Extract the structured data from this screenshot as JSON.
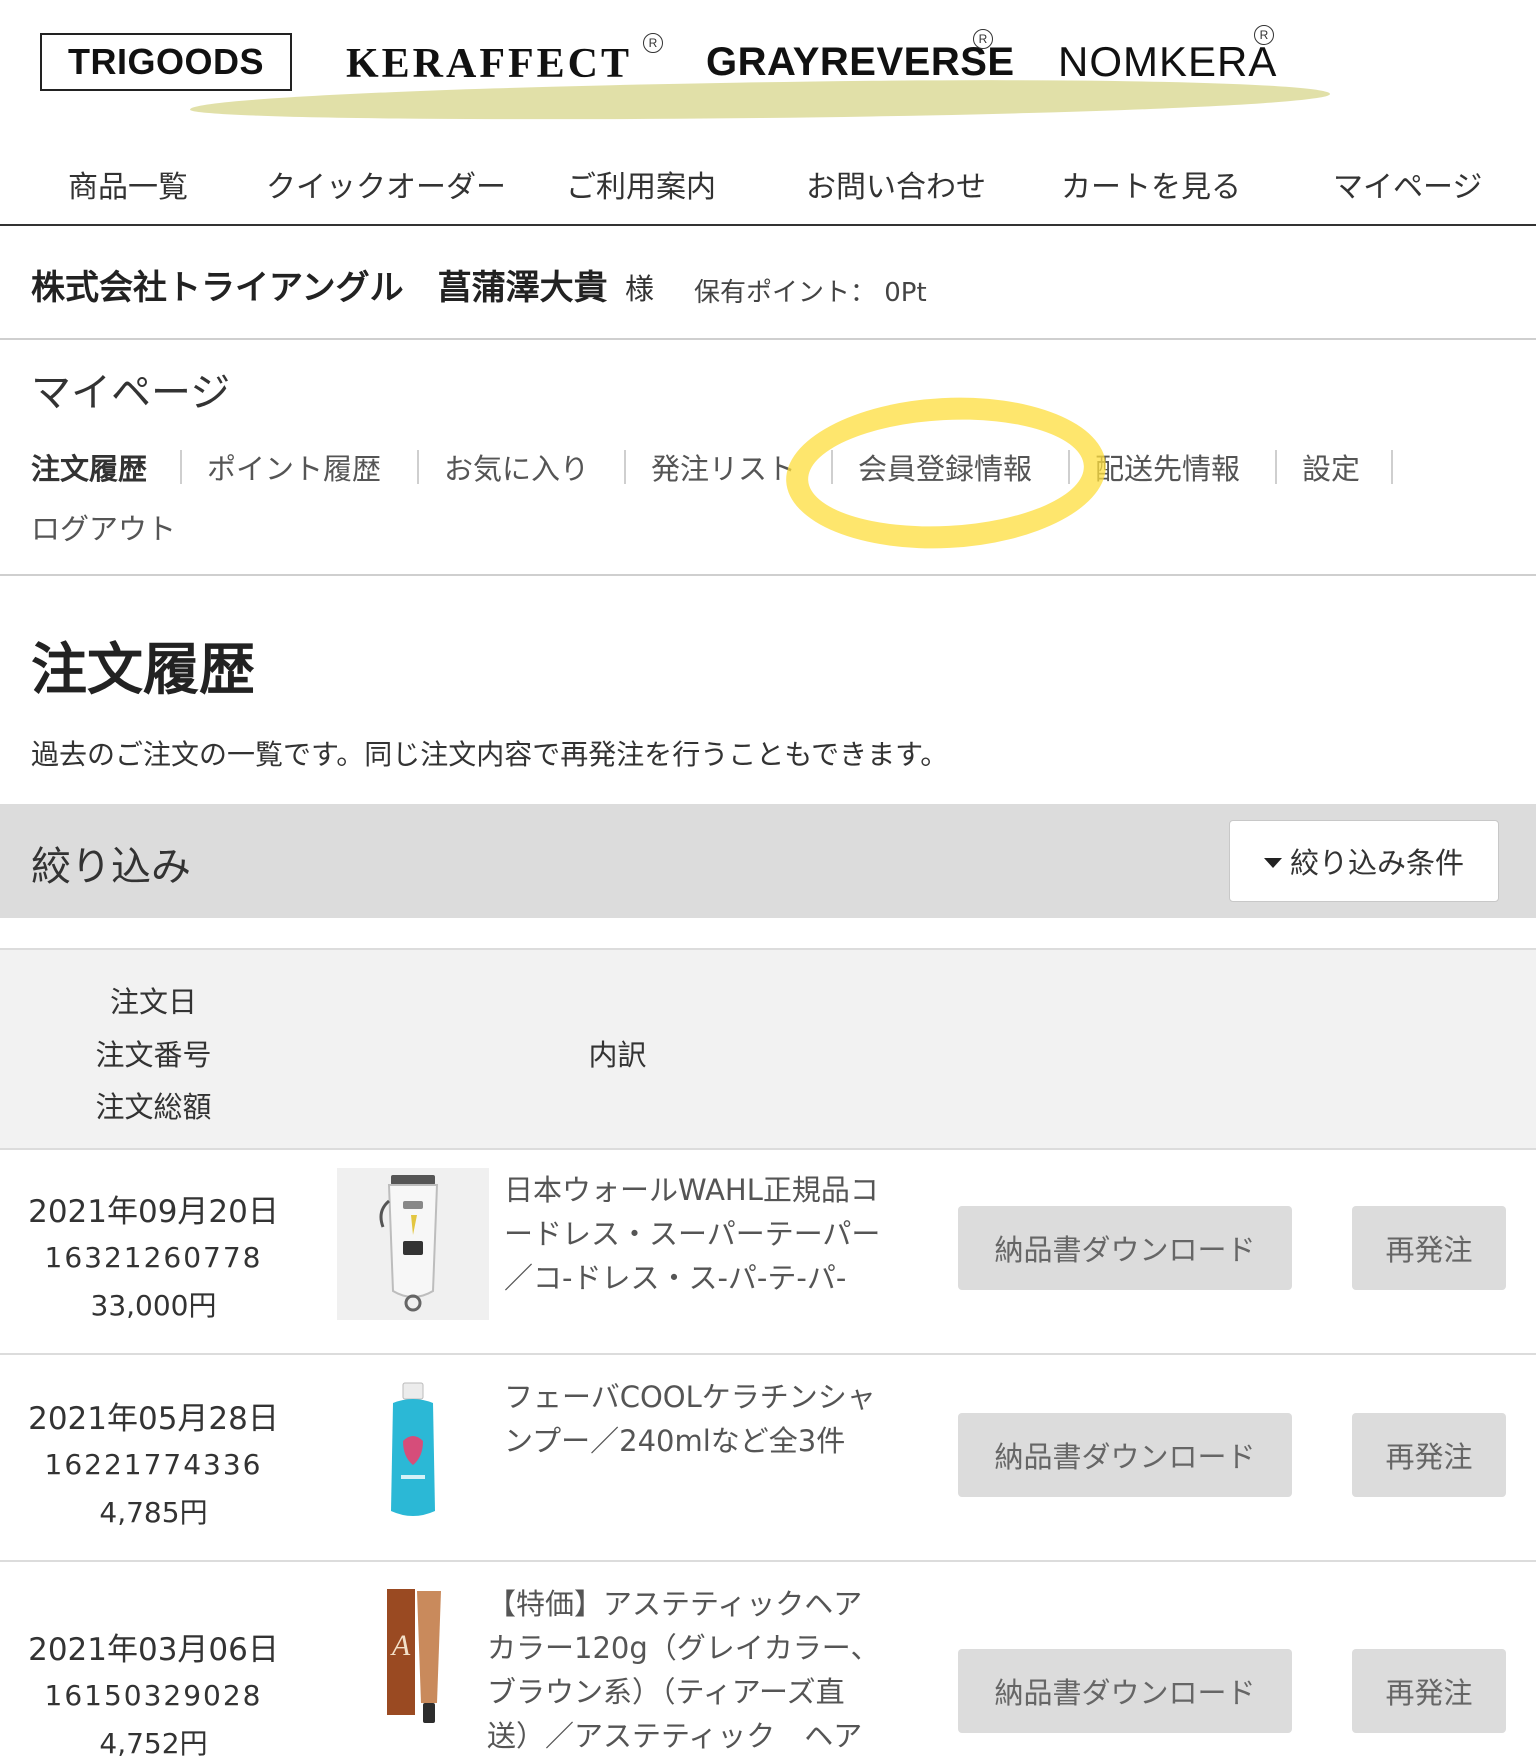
{
  "brands": {
    "trigoods": "TRIGOODS",
    "keraffect": "KERAFFECT",
    "grayreverse": "GRAYREVERSE",
    "nomkera": "NOMKERA",
    "registered_mark": "R"
  },
  "global_nav": {
    "products": "商品一覧",
    "quick_order": "クイックオーダー",
    "guide": "ご利用案内",
    "contact": "お問い合わせ",
    "cart": "カートを見る",
    "mypage": "マイページ"
  },
  "user": {
    "company_name": "株式会社トライアングル　菖蒲澤大貴",
    "honorific": "様",
    "points": "保有ポイント： 0Pt"
  },
  "mypage": {
    "heading": "マイページ",
    "tabs": [
      {
        "label": "注文履歴",
        "active": true
      },
      {
        "label": "ポイント履歴",
        "active": false
      },
      {
        "label": "お気に入り",
        "active": false
      },
      {
        "label": "発注リスト",
        "active": false
      },
      {
        "label": "会員登録情報",
        "active": false
      },
      {
        "label": "配送先情報",
        "active": false
      },
      {
        "label": "設定",
        "active": false
      },
      {
        "label": "ログアウト",
        "active": false
      }
    ],
    "highlight_color": "#fdde3c"
  },
  "page": {
    "title": "注文履歴",
    "description": "過去のご注文の一覧です。同じ注文内容で再発注を行うこともできます。"
  },
  "filter": {
    "label": "絞り込み",
    "button_label": "絞り込み条件"
  },
  "table": {
    "header": {
      "date": "注文日",
      "order_number": "注文番号",
      "total": "注文総額",
      "detail": "内訳"
    },
    "rows": [
      {
        "date": "2021年09月20日",
        "order_number": "16321260778",
        "total": "33,000円",
        "description": "日本ウォールWAHL正規品コードレス・スーパーテーパー／コ-ドレス・ス-パ-テ-パ-",
        "invoice_label": "納品書ダウンロード",
        "reorder_label": "再発注",
        "thumb_icon": "hair-clipper-icon"
      },
      {
        "date": "2021年05月28日",
        "order_number": "16221774336",
        "total": "4,785円",
        "description": "フェーバCOOLケラチンシャンプー／240mlなど全3件",
        "invoice_label": "納品書ダウンロード",
        "reorder_label": "再発注",
        "thumb_icon": "shampoo-bottle-icon"
      },
      {
        "date": "2021年03月06日",
        "order_number": "16150329028",
        "total": "4,752円",
        "description": "【特価】アステティックヘアカラー120g（グレイカラー、ブラウン系）（ティアーズ直送）／アステティック　ヘア",
        "invoice_label": "納品書ダウンロード",
        "reorder_label": "再発注",
        "thumb_icon": "hair-color-tube-icon"
      }
    ]
  }
}
